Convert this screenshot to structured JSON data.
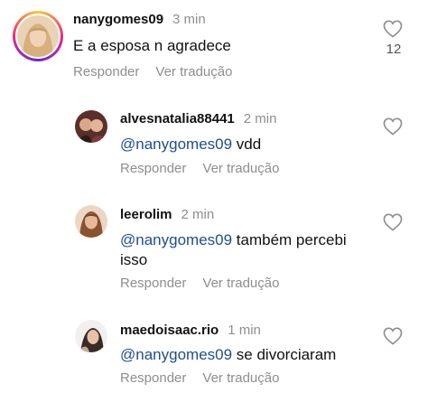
{
  "comments": [
    {
      "username": "nanygomes09",
      "time": "3 min",
      "mention": "",
      "text": "E a esposa n agradece",
      "reply_label": "Responder",
      "translate_label": "Ver tradução",
      "like_count": "12",
      "has_story_ring": true,
      "avatar_icon": "avatar-photo"
    },
    {
      "username": "alvesnatalia88441",
      "time": "2 min",
      "mention": "@nanygomes09",
      "text": "vdd",
      "reply_label": "Responder",
      "translate_label": "Ver tradução",
      "avatar_icon": "avatar-photo"
    },
    {
      "username": "leerolim",
      "time": "2 min",
      "mention": "@nanygomes09",
      "text": "também percebi isso",
      "reply_label": "Responder",
      "translate_label": "Ver tradução",
      "avatar_icon": "avatar-photo"
    },
    {
      "username": "maedoisaac.rio",
      "time": "1 min",
      "mention": "@nanygomes09",
      "text": "se divorciaram",
      "reply_label": "Responder",
      "translate_label": "Ver tradução",
      "avatar_icon": "avatar-photo"
    }
  ],
  "colors": {
    "mention": "#1f4e8c",
    "muted": "#8e8e8e",
    "ring_start": "#f9ce34",
    "ring_mid": "#ee2a7b"
  },
  "icons": {
    "like": "heart-outline-icon"
  }
}
